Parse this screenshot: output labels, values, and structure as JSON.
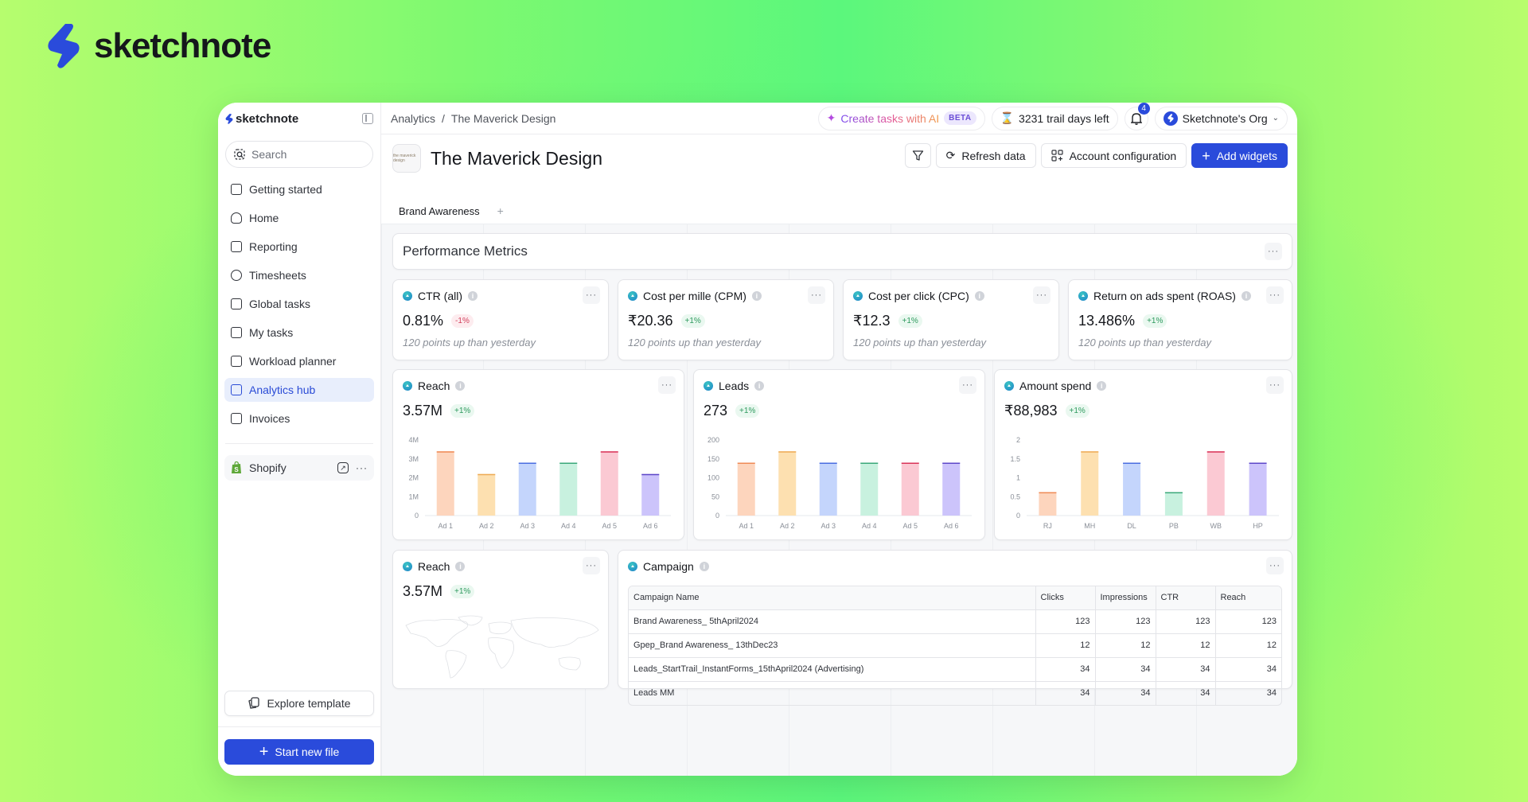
{
  "brand": {
    "name": "sketchnote",
    "color": "#2a4bdb"
  },
  "sidebar": {
    "logo": "sketchnote",
    "search_placeholder": "Search",
    "items": [
      {
        "label": "Getting started",
        "icon": "binoculars-icon",
        "active": false
      },
      {
        "label": "Home",
        "icon": "home-icon",
        "active": false
      },
      {
        "label": "Reporting",
        "icon": "report-icon",
        "active": false
      },
      {
        "label": "Timesheets",
        "icon": "stopwatch-icon",
        "active": false
      },
      {
        "label": "Global tasks",
        "icon": "clipboard-icon",
        "active": false
      },
      {
        "label": "My tasks",
        "icon": "checklist-icon",
        "active": false
      },
      {
        "label": "Workload planner",
        "icon": "notebook-icon",
        "active": false
      },
      {
        "label": "Analytics hub",
        "icon": "analytics-icon",
        "active": true
      },
      {
        "label": "Invoices",
        "icon": "invoice-icon",
        "active": false
      }
    ],
    "integration": {
      "label": "Shopify",
      "icon": "shopify-icon"
    },
    "explore_label": "Explore template",
    "start_label": "Start new file"
  },
  "topbar": {
    "breadcrumb": [
      "Analytics",
      "The Maverick Design"
    ],
    "breadcrumb_sep": "/",
    "ai_label": "Create tasks with AI",
    "ai_badge": "BETA",
    "trial_label": "3231 trail days left",
    "notifications_count": "4",
    "org_label": "Sketchnote's Org"
  },
  "header": {
    "title": "The Maverick Design",
    "logo_text": "the maverick design",
    "refresh_label": "Refresh data",
    "account_label": "Account configuration",
    "add_label": "Add widgets",
    "tabs": [
      {
        "label": "Brand Awareness",
        "active": true
      }
    ],
    "add_tab": "+"
  },
  "section": {
    "title": "Performance Metrics",
    "more": "···"
  },
  "kpis": [
    {
      "title": "CTR (all)",
      "value": "0.81%",
      "delta": "-1%",
      "trend": "down",
      "sub": "120 points up than yesterday"
    },
    {
      "title": "Cost per mille (CPM)",
      "value": "₹20.36",
      "delta": "+1%",
      "trend": "up",
      "sub": "120 points up than yesterday"
    },
    {
      "title": "Cost per click (CPC)",
      "value": "₹12.3",
      "delta": "+1%",
      "trend": "up",
      "sub": "120 points up than yesterday"
    },
    {
      "title": "Return on ads spent (ROAS)",
      "value": "13.486%",
      "delta": "+1%",
      "trend": "up",
      "sub": "120 points up than yesterday"
    }
  ],
  "charts": [
    {
      "title": "Reach",
      "value": "3.57M",
      "delta": "+1%"
    },
    {
      "title": "Leads",
      "value": "273",
      "delta": "+1%"
    },
    {
      "title": "Amount spend",
      "value": "₹88,983",
      "delta": "+1%"
    }
  ],
  "bar_colors": [
    {
      "fill": "#fdd5bd",
      "top": "#ef8a55"
    },
    {
      "fill": "#fde0b0",
      "top": "#eeaa55"
    },
    {
      "fill": "#c4d5fc",
      "top": "#4a6de0"
    },
    {
      "fill": "#c8f1df",
      "top": "#3aa879"
    },
    {
      "fill": "#fbc9d3",
      "top": "#d93358"
    },
    {
      "fill": "#ccc4fb",
      "top": "#5c47c8"
    }
  ],
  "chart_data": [
    {
      "type": "bar",
      "title": "Reach",
      "categories": [
        "Ad 1",
        "Ad 2",
        "Ad 3",
        "Ad 4",
        "Ad 5",
        "Ad 6"
      ],
      "values": [
        3.4,
        2.2,
        2.8,
        2.8,
        3.4,
        2.2
      ],
      "yticks": [
        "0",
        "1M",
        "2M",
        "3M",
        "4M"
      ],
      "ylim": [
        0,
        4
      ],
      "xlabel": "",
      "ylabel": "",
      "grid": false
    },
    {
      "type": "bar",
      "title": "Leads",
      "categories": [
        "Ad 1",
        "Ad 2",
        "Ad 3",
        "Ad 4",
        "Ad 5",
        "Ad 6"
      ],
      "values": [
        140,
        170,
        140,
        140,
        140,
        140
      ],
      "yticks": [
        "0",
        "50",
        "100",
        "150",
        "200"
      ],
      "ylim": [
        0,
        200
      ],
      "xlabel": "",
      "ylabel": "",
      "grid": false
    },
    {
      "type": "bar",
      "title": "Amount spend",
      "categories": [
        "RJ",
        "MH",
        "DL",
        "PB",
        "WB",
        "HP"
      ],
      "values": [
        0.62,
        1.7,
        1.4,
        0.62,
        1.7,
        1.4
      ],
      "yticks": [
        "0",
        "0.5",
        "1",
        "1.5",
        "2"
      ],
      "ylim": [
        0,
        2
      ],
      "xlabel": "",
      "ylabel": "",
      "grid": false
    }
  ],
  "map_widget": {
    "title": "Reach",
    "value": "3.57M",
    "delta": "+1%"
  },
  "campaign": {
    "title": "Campaign",
    "columns": [
      "Campaign Name",
      "Clicks",
      "Impressions",
      "CTR",
      "Reach"
    ],
    "rows": [
      [
        "Brand Awareness_ 5thApril2024",
        "123",
        "123",
        "123",
        "123"
      ],
      [
        "Gpep_Brand Awareness_ 13thDec23",
        "12",
        "12",
        "12",
        "12"
      ],
      [
        "Leads_StartTrail_InstantForms_15thApril2024 (Advertising)",
        "34",
        "34",
        "34",
        "34"
      ],
      [
        "Leads MM",
        "34",
        "34",
        "34",
        "34"
      ]
    ]
  }
}
